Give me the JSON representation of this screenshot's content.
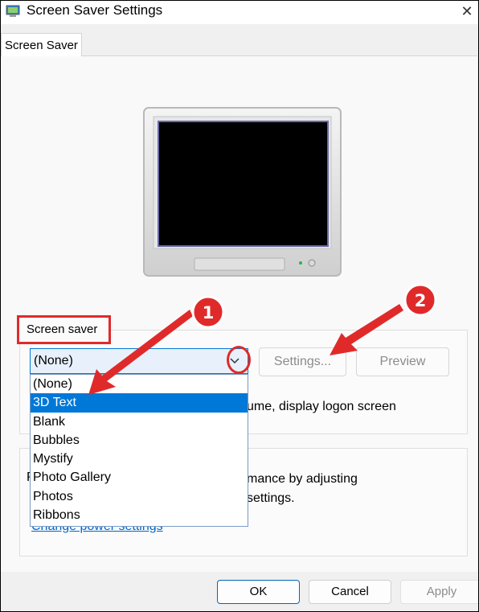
{
  "window": {
    "title": "Screen Saver Settings",
    "close_glyph": "✕"
  },
  "tabs": [
    {
      "label": "Screen Saver",
      "active": true
    }
  ],
  "screen_saver_group": {
    "label": "Screen saver",
    "selected_value": "(None)",
    "options": [
      "(None)",
      "3D Text",
      "Blank",
      "Bubbles",
      "Mystify",
      "Photo Gallery",
      "Photos",
      "Ribbons"
    ],
    "highlighted_option": "3D Text",
    "settings_button": "Settings...",
    "preview_button": "Preview",
    "resume_text_visible": "ume, display logon screen"
  },
  "power_group": {
    "label_visible": "P",
    "text_line1_visible": "mance by adjusting",
    "text_line2_visible": "settings.",
    "link_text": "Change power settings"
  },
  "buttons": {
    "ok": "OK",
    "cancel": "Cancel",
    "apply": "Apply"
  },
  "annotations": {
    "badge_1": "1",
    "badge_2": "2",
    "color": "#e02a2a"
  },
  "icons": {
    "combo_arrow": "chevron-down-icon",
    "close": "close-icon",
    "app": "screensaver-app-icon"
  }
}
